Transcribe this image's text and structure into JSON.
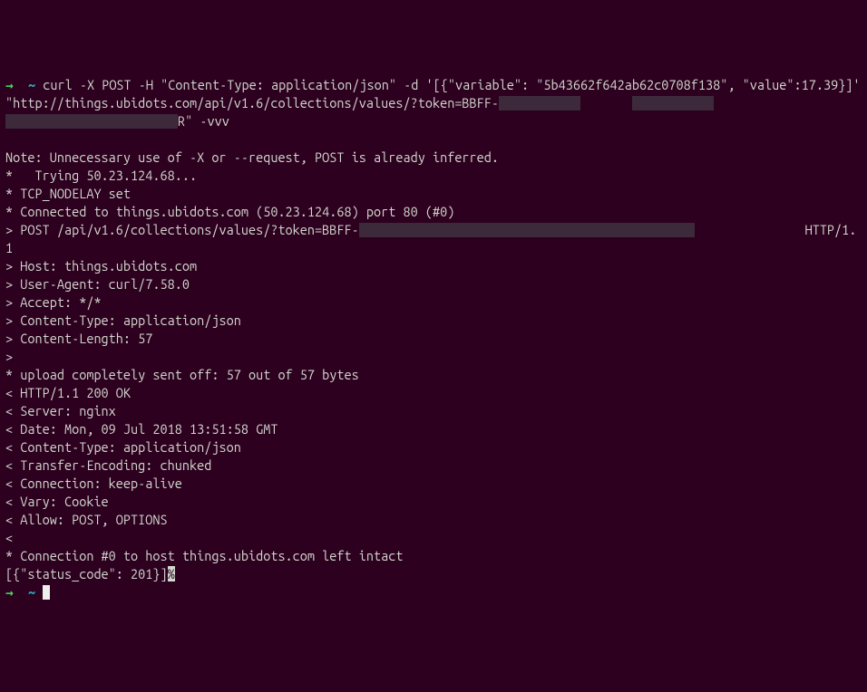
{
  "prompt": {
    "arrow": "→",
    "tilde": "~"
  },
  "command_line": {
    "text": "curl -X POST -H \"Content-Type: application/json\" -d '[{\"variable\": \"5b43662f642ab62c0708f138\", \"value\":17.39}]' \"http://things.ubidots.com/api/v1.6/collections/values/?token=BBFF-",
    "trail_char": "R",
    "flags": "\" -vvv"
  },
  "output": {
    "l1": "Note: Unnecessary use of -X or --request, POST is already inferred.",
    "l2": "*   Trying 50.23.124.68...",
    "l3": "* TCP_NODELAY set",
    "l4": "* Connected to things.ubidots.com (50.23.124.68) port 80 (#0)",
    "l5a": "> POST /api/v1.6/collections/values/?token=BBFF-",
    "l5b": " HTTP/1.1",
    "l6": "> Host: things.ubidots.com",
    "l7": "> User-Agent: curl/7.58.0",
    "l8": "> Accept: */*",
    "l9": "> Content-Type: application/json",
    "l10": "> Content-Length: 57",
    "l11": ">",
    "l12": "* upload completely sent off: 57 out of 57 bytes",
    "l13": "< HTTP/1.1 200 OK",
    "l14": "< Server: nginx",
    "l15": "< Date: Mon, 09 Jul 2018 13:51:58 GMT",
    "l16": "< Content-Type: application/json",
    "l17": "< Transfer-Encoding: chunked",
    "l18": "< Connection: keep-alive",
    "l19": "< Vary: Cookie",
    "l20": "< Allow: POST, OPTIONS",
    "l21": "<",
    "l22": "* Connection #0 to host things.ubidots.com left intact",
    "l23": "[{\"status_code\": 201}]",
    "l23_suffix": "%"
  }
}
